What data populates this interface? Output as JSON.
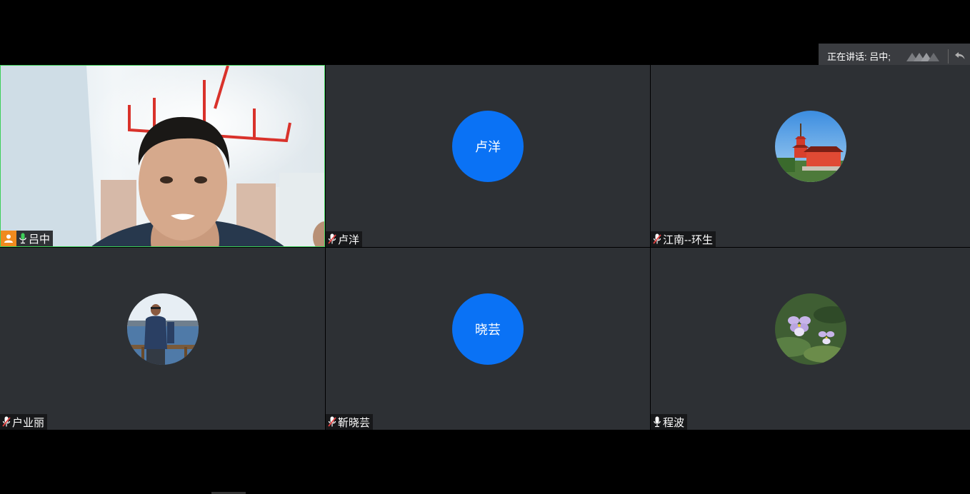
{
  "speaking": {
    "label": "正在讲话: 吕中;"
  },
  "participants": [
    {
      "name": "吕中",
      "type": "video",
      "mic": "on",
      "host": true,
      "active": true
    },
    {
      "name": "卢洋",
      "type": "text-avatar",
      "avatar_text": "卢洋",
      "mic": "muted"
    },
    {
      "name": "江南--环生",
      "type": "image-avatar",
      "avatar_icon": "pagoda-photo-icon",
      "mic": "muted"
    },
    {
      "name": "户业丽",
      "type": "image-avatar",
      "avatar_icon": "person-lakeside-photo-icon",
      "mic": "muted"
    },
    {
      "name": "靳晓芸",
      "type": "text-avatar",
      "avatar_text": "晓芸",
      "mic": "muted"
    },
    {
      "name": "程波",
      "type": "image-avatar",
      "avatar_icon": "violet-flower-photo-icon",
      "mic": "on-white"
    }
  ],
  "colors": {
    "tile_bg": "#2d3034",
    "avatar_blue": "#0a72f5",
    "active_border": "#3ecf5a",
    "host_badge": "#f08a1e",
    "mic_on": "#3ecf5a",
    "mic_muted": "#e04040"
  }
}
